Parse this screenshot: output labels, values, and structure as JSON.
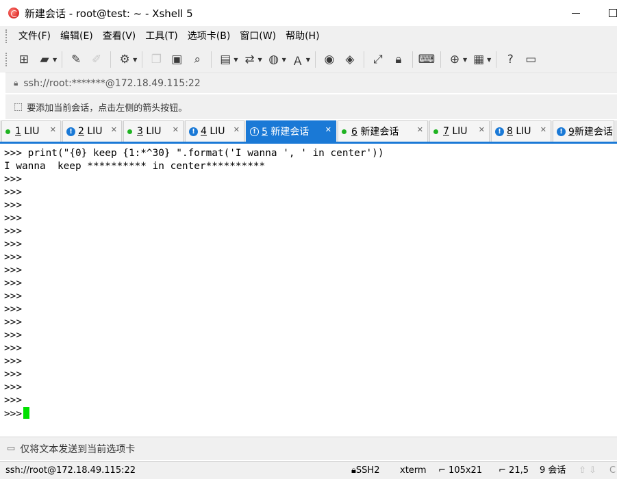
{
  "window": {
    "title": "新建会话 - root@test: ~ - Xshell 5"
  },
  "menu": [
    "文件(F)",
    "编辑(E)",
    "查看(V)",
    "工具(T)",
    "选项卡(B)",
    "窗口(W)",
    "帮助(H)"
  ],
  "toolbar_icons": [
    "new-session-icon",
    "open-folder-icon",
    "reconnect-icon",
    "disconnect-icon",
    "properties-icon",
    "copy-icon",
    "paste-icon",
    "find-icon",
    "print-icon",
    "transfer-icon",
    "globe-icon",
    "font-icon",
    "xftp-icon",
    "xmanager-icon",
    "fullscreen-icon",
    "lock-icon",
    "keyboard-icon",
    "add-tab-icon",
    "layout-icon",
    "help-icon",
    "chat-icon"
  ],
  "address": {
    "text": "ssh://root:*******@172.18.49.115:22"
  },
  "hint": {
    "text": "要添加当前会话，点击左侧的箭头按钮。"
  },
  "tabs": [
    {
      "num": "1",
      "name": "LIU",
      "status": "connected",
      "active": false
    },
    {
      "num": "2",
      "name": "LIU",
      "status": "warning",
      "active": false
    },
    {
      "num": "3",
      "name": "LIU",
      "status": "connected",
      "active": false
    },
    {
      "num": "4",
      "name": "LIU",
      "status": "warning",
      "active": false
    },
    {
      "num": "5",
      "name": "新建会话",
      "status": "warning",
      "active": true
    },
    {
      "num": "6",
      "name": "新建会话",
      "status": "connected",
      "active": false
    },
    {
      "num": "7",
      "name": "LIU",
      "status": "connected",
      "active": false
    },
    {
      "num": "8",
      "name": "LIU",
      "status": "warning",
      "active": false
    },
    {
      "num": "9",
      "name": "新建会话",
      "status": "warning",
      "active": false
    }
  ],
  "terminal": {
    "lines": [
      ">>> print(\"{0} keep {1:*^30} \".format('I wanna ', ' in center'))",
      "I wanna  keep ********** in center**********",
      ">>>",
      ">>>",
      ">>>",
      ">>>",
      ">>>",
      ">>>",
      ">>>",
      ">>>",
      ">>>",
      ">>>",
      ">>>",
      ">>>",
      ">>>",
      ">>>",
      ">>>",
      ">>>",
      ">>>",
      ">>>",
      ">>>",
      ">>>"
    ]
  },
  "send_bar": {
    "text": "仅将文本发送到当前选项卡"
  },
  "status": {
    "connection": "ssh://root@172.18.49.115:22",
    "protocol": "SSH2",
    "terminal_type": "xterm",
    "size": "105x21",
    "position": "21,5",
    "sessions": "9 会话",
    "caps": "C"
  },
  "colors": {
    "accent": "#1a79d6",
    "connected": "#1fb322",
    "cursor": "#00e000"
  }
}
